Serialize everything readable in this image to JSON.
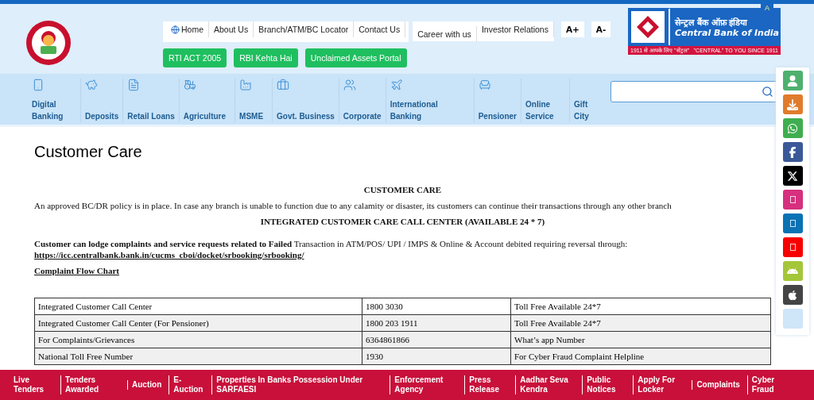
{
  "accessibility_label": "A",
  "top_links": [
    {
      "label": "Home"
    },
    {
      "label": "About Us"
    },
    {
      "label": "Branch/ATM/BC Locator"
    },
    {
      "label": "Contact Us"
    },
    {
      "label": "Career with us"
    },
    {
      "label": "Investor Relations"
    }
  ],
  "font_buttons": [
    "A+",
    "A-"
  ],
  "quick_links": [
    "RTI ACT 2005",
    "RBI Kehta Hai",
    "Unclaimed Assets Portal"
  ],
  "logo": {
    "hindi": "सेन्ट्रल बैंक ऑफ़ इंडिया",
    "english": "Central Bank of India",
    "tagline_hindi": "1911 से आपके लिए ''सेंट्रल''",
    "tagline_english": "\"CENTRAL\" TO YOU SINCE 1911"
  },
  "nav": [
    {
      "label": "Digital Banking"
    },
    {
      "label": "Deposits"
    },
    {
      "label": "Retail Loans"
    },
    {
      "label": "Agriculture"
    },
    {
      "label": "MSME"
    },
    {
      "label": "Govt. Business"
    },
    {
      "label": "Corporate"
    },
    {
      "label": "International Banking"
    },
    {
      "label": "Pensioner"
    },
    {
      "label": "Online Service"
    },
    {
      "label": "Gift City"
    }
  ],
  "page_title": "Customer Care",
  "article": {
    "heading": "CUSTOMER CARE",
    "notice": "An approved BC/DR policy is in place. In case any branch is unable to function due to any calamity or disaster, its customers can continue their transactions through any other branch",
    "subheading": "INTEGRATED CUSTOMER CARE CALL CENTER (AVAILABLE 24 * 7)",
    "complaint_text": "**Customer can lodge complaints and service requests related to Failed** Transaction in ATM/POS/ UPI / IMPS & Online & Account debited requiring reversal through:",
    "complaint_link": "https://icc.centralbank.bank.in/cucms_cboi/docket/srbooking/srbooking/",
    "flow_chart_link": "Complaint Flow Chart"
  },
  "table": {
    "rows": [
      [
        "Integrated Customer Call Center",
        "1800 3030",
        "Toll Free  Available 24*7"
      ],
      [
        "Integrated Customer Call Center (For Pensioner)",
        "1800 203 1911",
        "Toll Free  Available 24*7"
      ],
      [
        "For Complaints/Grievances",
        "6364861866",
        "What’s app Number"
      ],
      [
        "National Toll Free Number",
        "1930",
        "For  Cyber Fraud Complaint Helpline"
      ]
    ]
  },
  "social": [
    {
      "color": "#4fb06e"
    },
    {
      "color": "#e07b2c"
    },
    {
      "color": "#3fae4f"
    },
    {
      "color": "#3b5998"
    },
    {
      "color": "#000000"
    },
    {
      "color": "#d6307e"
    },
    {
      "color": "#0a72b5"
    },
    {
      "color": "#f70000"
    },
    {
      "color": "#a4c639"
    },
    {
      "color": "#444444"
    },
    {
      "color": "#cfe5f8"
    }
  ],
  "footer_links": [
    "Live Tenders",
    "Tenders Awarded",
    "Auction",
    "E-Auction",
    "Properties In Banks Possession Under SARFAESI",
    "Enforcement Agency",
    "Press Release",
    "Aadhar Seva Kendra",
    "Public Notices",
    "Apply For Locker",
    "Complaints",
    "Cyber Fraud"
  ]
}
